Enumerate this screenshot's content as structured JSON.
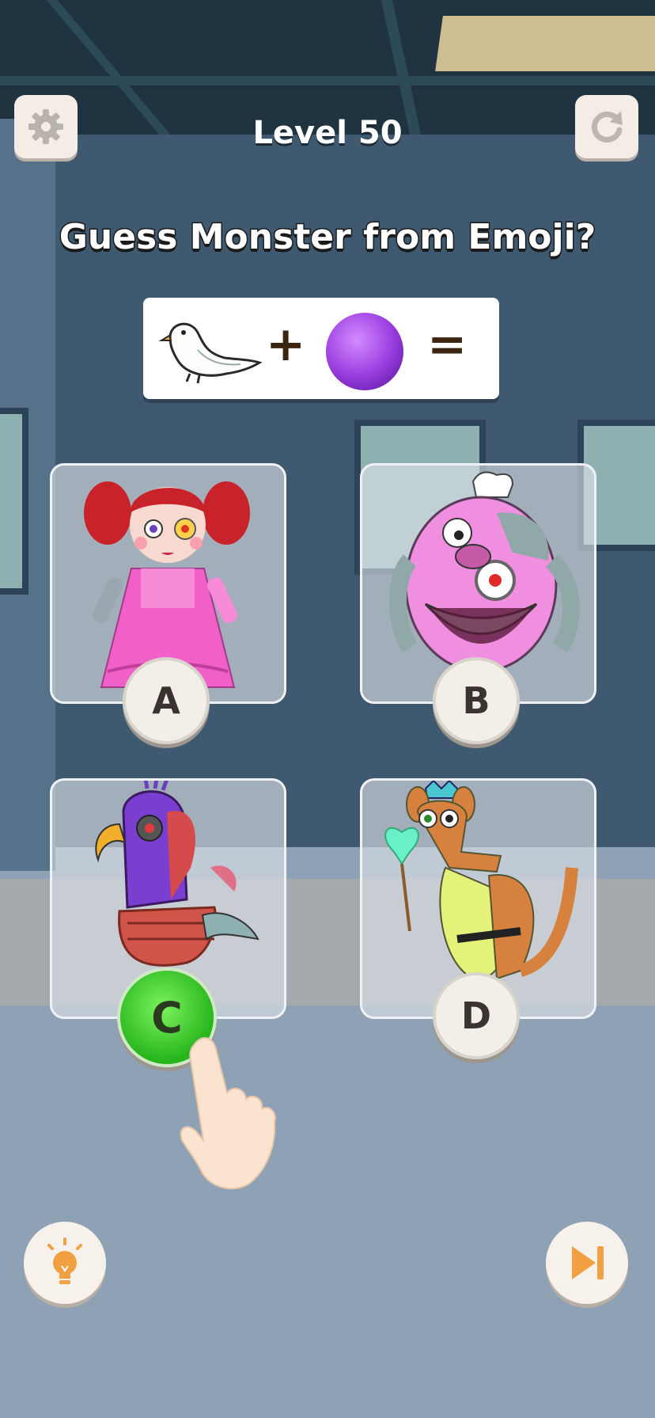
{
  "header": {
    "level_text": "Level 50",
    "settings_icon": "gear-icon",
    "restart_icon": "restart-icon"
  },
  "question": "Guess Monster from Emoji?",
  "clue": {
    "emoji_1": "white-bird",
    "plus": "+",
    "emoji_2": "purple-circle",
    "equals": "="
  },
  "options": [
    {
      "letter": "A",
      "monster": "pink-doll-monster",
      "selected": false
    },
    {
      "letter": "B",
      "monster": "pink-pig-robot-monster",
      "selected": false
    },
    {
      "letter": "C",
      "monster": "purple-bird-robot-monster",
      "selected": true
    },
    {
      "letter": "D",
      "monster": "kangaroo-queen-monster",
      "selected": false
    }
  ],
  "footer": {
    "hint_icon": "lightbulb-icon",
    "skip_icon": "skip-icon"
  },
  "colors": {
    "selected_green": "#36c428",
    "accent_orange": "#f0a040"
  }
}
